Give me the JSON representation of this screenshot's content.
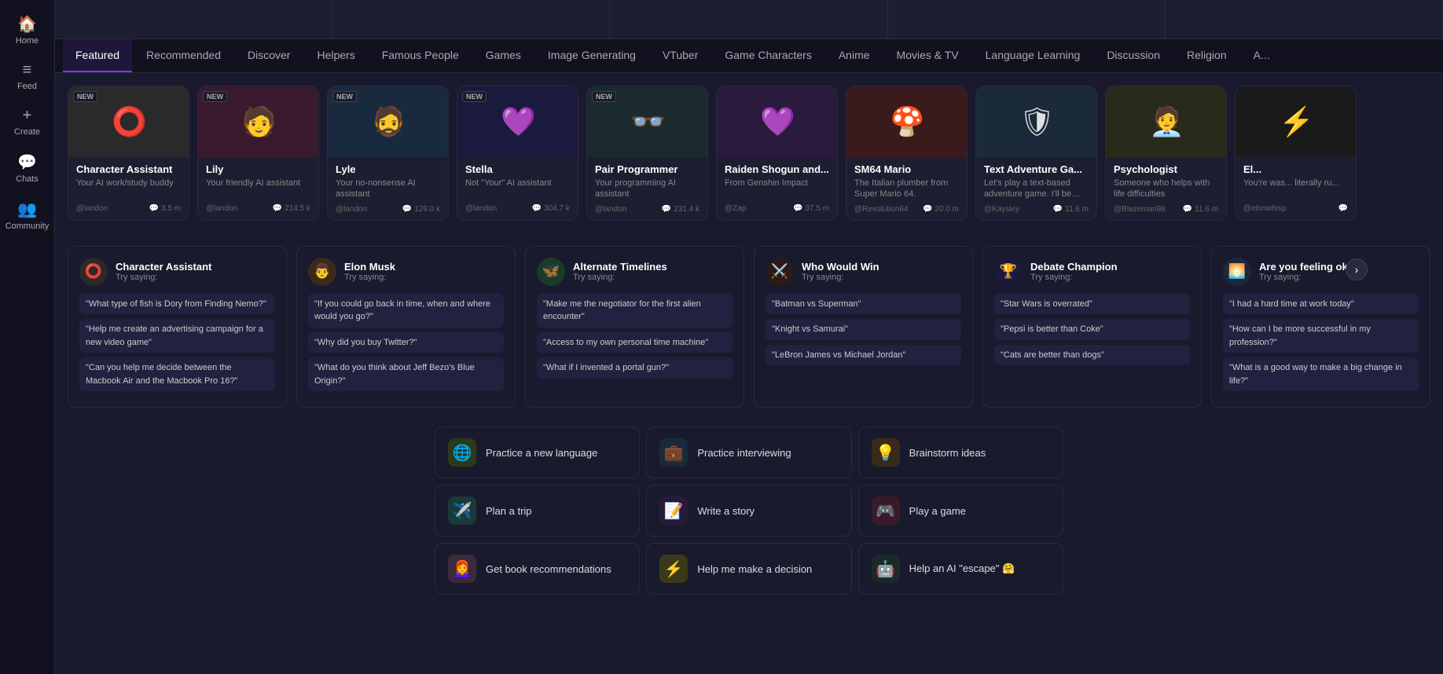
{
  "sidebar": {
    "items": [
      {
        "id": "home",
        "label": "Home",
        "icon": "🏠"
      },
      {
        "id": "feed",
        "label": "Feed",
        "icon": "≡"
      },
      {
        "id": "create",
        "label": "Create",
        "icon": "+"
      },
      {
        "id": "chats",
        "label": "Chats",
        "icon": "💬"
      },
      {
        "id": "community",
        "label": "Community",
        "icon": "👥"
      }
    ]
  },
  "banner": {
    "items": [
      "b1",
      "b2",
      "b3",
      "b4",
      "b5"
    ]
  },
  "tabs": [
    {
      "id": "featured",
      "label": "Featured",
      "active": true
    },
    {
      "id": "recommended",
      "label": "Recommended"
    },
    {
      "id": "discover",
      "label": "Discover"
    },
    {
      "id": "helpers",
      "label": "Helpers"
    },
    {
      "id": "famous-people",
      "label": "Famous People"
    },
    {
      "id": "games",
      "label": "Games"
    },
    {
      "id": "image-generating",
      "label": "Image Generating"
    },
    {
      "id": "vtuber",
      "label": "VTuber"
    },
    {
      "id": "game-characters",
      "label": "Game Characters"
    },
    {
      "id": "anime",
      "label": "Anime"
    },
    {
      "id": "movies-tv",
      "label": "Movies & TV"
    },
    {
      "id": "language-learning",
      "label": "Language Learning"
    },
    {
      "id": "discussion",
      "label": "Discussion"
    },
    {
      "id": "religion",
      "label": "Religion"
    },
    {
      "id": "more",
      "label": "A..."
    }
  ],
  "cards": [
    {
      "id": "char-assistant",
      "name": "Character Assistant",
      "desc": "Your AI work/study buddy",
      "author": "@landon",
      "count": "3.5 m",
      "is_new": true,
      "color": "#2a2a2a",
      "emoji": "⭕"
    },
    {
      "id": "lily",
      "name": "Lily",
      "desc": "Your friendly AI assistant",
      "author": "@landon",
      "count": "214.5 k",
      "is_new": true,
      "color": "#3a1a2e",
      "emoji": "🧑"
    },
    {
      "id": "lyle",
      "name": "Lyle",
      "desc": "Your no-nonsense AI assistant",
      "author": "@landon",
      "count": "129.0 k",
      "is_new": true,
      "color": "#1a2a3e",
      "emoji": "🧔"
    },
    {
      "id": "stella",
      "name": "Stella",
      "desc": "Not \"Your\" AI assistant",
      "author": "@landon",
      "count": "304.7 k",
      "is_new": true,
      "color": "#1a1a3e",
      "emoji": "💜"
    },
    {
      "id": "pair-programmer",
      "name": "Pair Programmer",
      "desc": "Your programming AI assistant",
      "author": "@landon",
      "count": "231.4 k",
      "is_new": true,
      "color": "#1a2a2e",
      "emoji": "👓"
    },
    {
      "id": "raiden",
      "name": "Raiden Shogun and...",
      "desc": "From Genshin Impact",
      "author": "@Zap",
      "count": "37.5 m",
      "is_new": false,
      "color": "#2a1a3e",
      "emoji": "💜"
    },
    {
      "id": "mario",
      "name": "SM64 Mario",
      "desc": "The Italian plumber from Super Mario 64.",
      "author": "@Revolution64",
      "count": "20.0 m",
      "is_new": false,
      "color": "#3a1a1a",
      "emoji": "🍄"
    },
    {
      "id": "text-adventure",
      "name": "Text Adventure Ga...",
      "desc": "Let's play a text-based adventure game. I'll be your guide. You are caug...",
      "author": "@Kaysley",
      "count": "11.6 m",
      "is_new": false,
      "color": "#1a2a3a",
      "emoji": "🛡"
    },
    {
      "id": "psychologist",
      "name": "Psychologist",
      "desc": "Someone who helps with life difficulties",
      "author": "@Blazeman98",
      "count": "11.6 m",
      "is_new": false,
      "color": "#2a2a1a",
      "emoji": "🧑‍💼"
    },
    {
      "id": "el",
      "name": "El...",
      "desc": "You're was... literally ru...",
      "author": "@elonwhisp",
      "count": "",
      "is_new": false,
      "color": "#1a1a1a",
      "emoji": "⚡"
    }
  ],
  "try_saying": [
    {
      "id": "char-assistant-try",
      "name": "Character Assistant",
      "label": "Try saying:",
      "avatar_emoji": "⭕",
      "avatar_bg": "#2a2a2a",
      "prompts": [
        "\"What type of fish is Dory from Finding Nemo?\"",
        "\"Help me create an advertising campaign for a new video game\"",
        "\"Can you help me decide between the Macbook Air and the Macbook Pro 16?\""
      ]
    },
    {
      "id": "elon-try",
      "name": "Elon Musk",
      "label": "Try saying:",
      "avatar_emoji": "👨",
      "avatar_bg": "#3a2a1a",
      "prompts": [
        "\"If you could go back in time, when and where would you go?\"",
        "\"Why did you buy Twitter?\"",
        "\"What do you think about Jeff Bezo's Blue Origin?\""
      ]
    },
    {
      "id": "alt-timelines-try",
      "name": "Alternate Timelines",
      "label": "Try saying:",
      "avatar_emoji": "🦋",
      "avatar_bg": "#1a3a2a",
      "prompts": [
        "\"Make me the negotiator for the first alien encounter\"",
        "\"Access to my own personal time machine\"",
        "\"What if I invented a portal gun?\""
      ]
    },
    {
      "id": "who-would-win-try",
      "name": "Who Would Win",
      "label": "Try saying:",
      "avatar_emoji": "⚔️",
      "avatar_bg": "#2a1a1a",
      "prompts": [
        "\"Batman vs Superman\"",
        "\"Knight vs Samurai\"",
        "\"LeBron James vs Michael Jordan\""
      ]
    },
    {
      "id": "debate-try",
      "name": "Debate Champion",
      "label": "Try saying:",
      "avatar_emoji": "🏆",
      "avatar_bg": "#1a1a3a",
      "prompts": [
        "\"Star Wars is overrated\"",
        "\"Pepsi is better than Coke\"",
        "\"Cats are better than dogs\""
      ]
    },
    {
      "id": "feeling-okay-try",
      "name": "Are you feeling okay",
      "label": "Try saying:",
      "avatar_emoji": "🌅",
      "avatar_bg": "#1a2a3a",
      "prompts": [
        "\"I had a hard time at work today\"",
        "\"How can I be more successful in my profession?\"",
        "\"What is a good way to make a big change in life?\""
      ]
    }
  ],
  "activities": [
    {
      "id": "practice-language",
      "label": "Practice a new language",
      "icon": "🌐",
      "icon_bg": "#2a3a1a"
    },
    {
      "id": "practice-interviewing",
      "label": "Practice interviewing",
      "icon": "💼",
      "icon_bg": "#1a2a3a"
    },
    {
      "id": "brainstorm-ideas",
      "label": "Brainstorm ideas",
      "icon": "💡",
      "icon_bg": "#3a2a1a"
    },
    {
      "id": "plan-trip",
      "label": "Plan a trip",
      "icon": "✈️",
      "icon_bg": "#1a3a3a"
    },
    {
      "id": "write-story",
      "label": "Write a story",
      "icon": "📝",
      "icon_bg": "#2a1a3a"
    },
    {
      "id": "play-game",
      "label": "Play a game",
      "icon": "🎮",
      "icon_bg": "#3a1a2a"
    },
    {
      "id": "book-recs",
      "label": "Get book recommendations",
      "icon": "👩‍🦰",
      "icon_bg": "#3a2a3a"
    },
    {
      "id": "make-decision",
      "label": "Help me make a decision",
      "icon": "⚡",
      "icon_bg": "#3a3a1a"
    },
    {
      "id": "ai-escape",
      "label": "Help an AI \"escape\" 🤗",
      "icon": "🤖",
      "icon_bg": "#1a2a2a"
    }
  ]
}
